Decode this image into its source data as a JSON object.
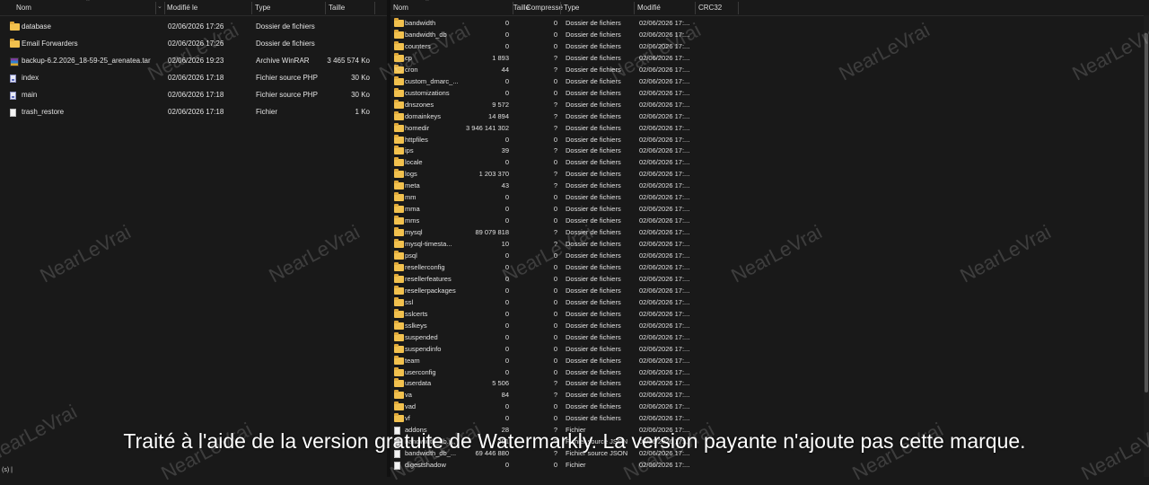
{
  "left": {
    "columns": [
      "Nom",
      "Modifié le",
      "Type",
      "Taille"
    ],
    "rows": [
      {
        "name": "database",
        "modified": "02/06/2026 17:26",
        "type": "Dossier de fichiers",
        "size": "",
        "icon": "folder-icon"
      },
      {
        "name": "Email Forwarders",
        "modified": "02/06/2026 17:26",
        "type": "Dossier de fichiers",
        "size": "",
        "icon": "folder-icon"
      },
      {
        "name": "backup-6.2.2026_18-59-25_arenatea.tar",
        "modified": "02/06/2026 19:23",
        "type": "Archive WinRAR",
        "size": "3 465 574 Ko",
        "icon": "rar-archive-icon"
      },
      {
        "name": "index",
        "modified": "02/06/2026 17:18",
        "type": "Fichier source PHP",
        "size": "30 Ko",
        "icon": "php-file-icon"
      },
      {
        "name": "main",
        "modified": "02/06/2026 17:18",
        "type": "Fichier source PHP",
        "size": "30 Ko",
        "icon": "php-file-icon"
      },
      {
        "name": "trash_restore",
        "modified": "02/06/2026 17:18",
        "type": "Fichier",
        "size": "1 Ko",
        "icon": "file-icon"
      }
    ],
    "status": "(s)  |"
  },
  "right": {
    "columns": [
      "Nom",
      "Taille",
      "Compressé",
      "Type",
      "Modifié",
      "CRC32"
    ],
    "rows": [
      {
        "name": "bandwidth",
        "size": "0",
        "packed": "0",
        "type": "Dossier de fichiers",
        "modified": "02/06/2026 17:...",
        "icon": "folder-icon"
      },
      {
        "name": "bandwidth_db",
        "size": "0",
        "packed": "0",
        "type": "Dossier de fichiers",
        "modified": "02/06/2026 17:...",
        "icon": "folder-icon"
      },
      {
        "name": "counters",
        "size": "0",
        "packed": "0",
        "type": "Dossier de fichiers",
        "modified": "02/06/2026 17:...",
        "icon": "folder-icon"
      },
      {
        "name": "cp",
        "size": "1 893",
        "packed": "?",
        "type": "Dossier de fichiers",
        "modified": "02/06/2026 17:...",
        "icon": "folder-icon"
      },
      {
        "name": "cron",
        "size": "44",
        "packed": "?",
        "type": "Dossier de fichiers",
        "modified": "02/06/2026 17:...",
        "icon": "folder-icon"
      },
      {
        "name": "custom_dmarc_...",
        "size": "0",
        "packed": "0",
        "type": "Dossier de fichiers",
        "modified": "02/06/2026 17:...",
        "icon": "folder-icon"
      },
      {
        "name": "customizations",
        "size": "0",
        "packed": "0",
        "type": "Dossier de fichiers",
        "modified": "02/06/2026 17:...",
        "icon": "folder-icon"
      },
      {
        "name": "dnszones",
        "size": "9 572",
        "packed": "?",
        "type": "Dossier de fichiers",
        "modified": "02/06/2026 17:...",
        "icon": "folder-icon"
      },
      {
        "name": "domainkeys",
        "size": "14 894",
        "packed": "?",
        "type": "Dossier de fichiers",
        "modified": "02/06/2026 17:...",
        "icon": "folder-icon"
      },
      {
        "name": "homedir",
        "size": "3 946 141 302",
        "packed": "?",
        "type": "Dossier de fichiers",
        "modified": "02/06/2026 17:...",
        "icon": "folder-icon"
      },
      {
        "name": "httpfiles",
        "size": "0",
        "packed": "0",
        "type": "Dossier de fichiers",
        "modified": "02/06/2026 17:...",
        "icon": "folder-icon"
      },
      {
        "name": "ips",
        "size": "39",
        "packed": "?",
        "type": "Dossier de fichiers",
        "modified": "02/06/2026 17:...",
        "icon": "folder-icon"
      },
      {
        "name": "locale",
        "size": "0",
        "packed": "0",
        "type": "Dossier de fichiers",
        "modified": "02/06/2026 17:...",
        "icon": "folder-icon"
      },
      {
        "name": "logs",
        "size": "1 203 370",
        "packed": "?",
        "type": "Dossier de fichiers",
        "modified": "02/06/2026 17:...",
        "icon": "folder-icon"
      },
      {
        "name": "meta",
        "size": "43",
        "packed": "?",
        "type": "Dossier de fichiers",
        "modified": "02/06/2026 17:...",
        "icon": "folder-icon"
      },
      {
        "name": "mm",
        "size": "0",
        "packed": "0",
        "type": "Dossier de fichiers",
        "modified": "02/06/2026 17:...",
        "icon": "folder-icon"
      },
      {
        "name": "mma",
        "size": "0",
        "packed": "0",
        "type": "Dossier de fichiers",
        "modified": "02/06/2026 17:...",
        "icon": "folder-icon"
      },
      {
        "name": "mms",
        "size": "0",
        "packed": "0",
        "type": "Dossier de fichiers",
        "modified": "02/06/2026 17:...",
        "icon": "folder-icon"
      },
      {
        "name": "mysql",
        "size": "89 079 818",
        "packed": "?",
        "type": "Dossier de fichiers",
        "modified": "02/06/2026 17:...",
        "icon": "folder-icon"
      },
      {
        "name": "mysql-timesta...",
        "size": "10",
        "packed": "?",
        "type": "Dossier de fichiers",
        "modified": "02/06/2026 17:...",
        "icon": "folder-icon"
      },
      {
        "name": "psql",
        "size": "0",
        "packed": "0",
        "type": "Dossier de fichiers",
        "modified": "02/06/2026 17:...",
        "icon": "folder-icon"
      },
      {
        "name": "resellerconfig",
        "size": "0",
        "packed": "0",
        "type": "Dossier de fichiers",
        "modified": "02/06/2026 17:...",
        "icon": "folder-icon"
      },
      {
        "name": "resellerfeatures",
        "size": "0",
        "packed": "0",
        "type": "Dossier de fichiers",
        "modified": "02/06/2026 17:...",
        "icon": "folder-icon"
      },
      {
        "name": "resellerpackages",
        "size": "0",
        "packed": "0",
        "type": "Dossier de fichiers",
        "modified": "02/06/2026 17:...",
        "icon": "folder-icon"
      },
      {
        "name": "ssl",
        "size": "0",
        "packed": "0",
        "type": "Dossier de fichiers",
        "modified": "02/06/2026 17:...",
        "icon": "folder-icon"
      },
      {
        "name": "sslcerts",
        "size": "0",
        "packed": "0",
        "type": "Dossier de fichiers",
        "modified": "02/06/2026 17:...",
        "icon": "folder-icon"
      },
      {
        "name": "sslkeys",
        "size": "0",
        "packed": "0",
        "type": "Dossier de fichiers",
        "modified": "02/06/2026 17:...",
        "icon": "folder-icon"
      },
      {
        "name": "suspended",
        "size": "0",
        "packed": "0",
        "type": "Dossier de fichiers",
        "modified": "02/06/2026 17:...",
        "icon": "folder-icon"
      },
      {
        "name": "suspendinfo",
        "size": "0",
        "packed": "0",
        "type": "Dossier de fichiers",
        "modified": "02/06/2026 17:...",
        "icon": "folder-icon"
      },
      {
        "name": "team",
        "size": "0",
        "packed": "0",
        "type": "Dossier de fichiers",
        "modified": "02/06/2026 17:...",
        "icon": "folder-icon"
      },
      {
        "name": "userconfig",
        "size": "0",
        "packed": "0",
        "type": "Dossier de fichiers",
        "modified": "02/06/2026 17:...",
        "icon": "folder-icon"
      },
      {
        "name": "userdata",
        "size": "5 506",
        "packed": "?",
        "type": "Dossier de fichiers",
        "modified": "02/06/2026 17:...",
        "icon": "folder-icon"
      },
      {
        "name": "va",
        "size": "84",
        "packed": "?",
        "type": "Dossier de fichiers",
        "modified": "02/06/2026 17:...",
        "icon": "folder-icon"
      },
      {
        "name": "vad",
        "size": "0",
        "packed": "0",
        "type": "Dossier de fichiers",
        "modified": "02/06/2026 17:...",
        "icon": "folder-icon"
      },
      {
        "name": "vf",
        "size": "0",
        "packed": "0",
        "type": "Dossier de fichiers",
        "modified": "02/06/2026 17:...",
        "icon": "folder-icon"
      },
      {
        "name": "addons",
        "size": "28",
        "packed": "?",
        "type": "Fichier",
        "modified": "02/06/2026 17:...",
        "icon": "file-icon"
      },
      {
        "name": "bandwidth_db.j...",
        "size": "491",
        "packed": "?",
        "type": "Fichier source JSON",
        "modified": "02/06/2026 17:...",
        "icon": "file-icon"
      },
      {
        "name": "bandwidth_db_...",
        "size": "69 446 880",
        "packed": "?",
        "type": "Fichier source JSON",
        "modified": "02/06/2026 17:...",
        "icon": "file-icon"
      },
      {
        "name": "digestshadow",
        "size": "0",
        "packed": "0",
        "type": "Fichier",
        "modified": "02/06/2026 17:...",
        "icon": "file-icon"
      }
    ]
  },
  "watermark": {
    "text": "NearLeVrai",
    "banner": "Traité à l'aide de la version gratuite de Watermarkly. La version payante n'ajoute pas cette marque."
  }
}
